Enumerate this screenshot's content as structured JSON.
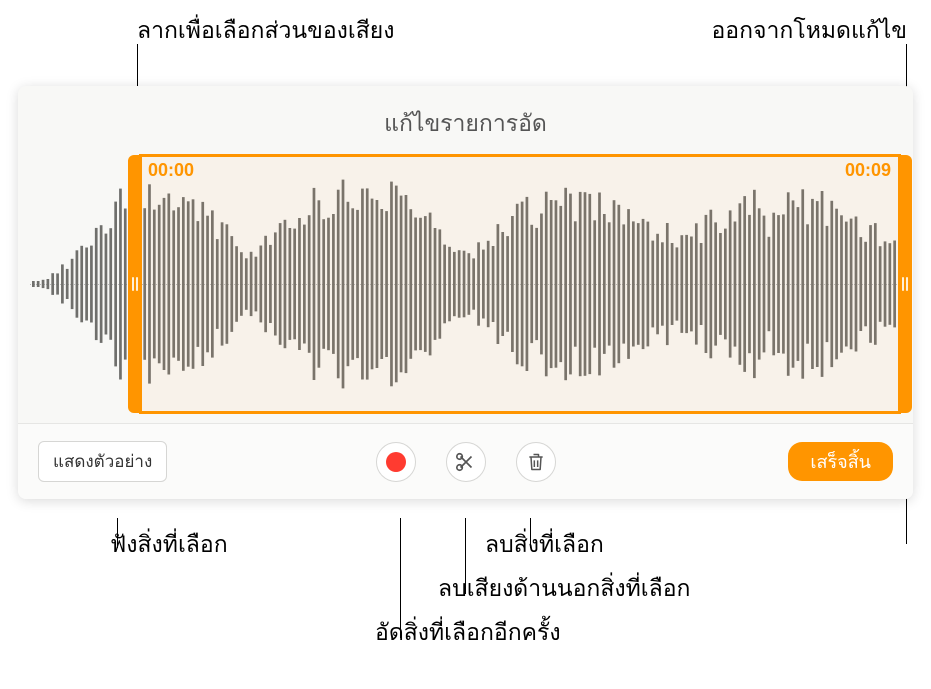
{
  "annotations": {
    "drag_select": "ลากเพื่อเลือกส่วนของเสียง",
    "exit_edit": "ออกจากโหมดแก้ไข",
    "listen_selection": "ฟังสิ่งที่เลือก",
    "delete_selection": "ลบสิ่งที่เลือก",
    "delete_outside_selection": "ลบเสียงด้านนอกสิ่งที่เลือก",
    "rerecord_selection": "อัดสิ่งที่เลือกอีกครั้ง"
  },
  "editor": {
    "title": "แก้ไขรายการอัด",
    "time_start": "00:00",
    "time_end": "00:09"
  },
  "toolbar": {
    "preview_label": "แสดงตัวอย่าง",
    "done_label": "เสร็จสิ้น"
  },
  "colors": {
    "accent": "#ff9500",
    "record": "#ff3b30",
    "waveform": "#6f6f6c"
  }
}
